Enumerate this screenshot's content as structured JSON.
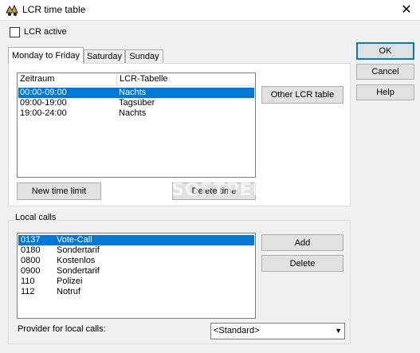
{
  "window": {
    "title": "LCR time table",
    "close_glyph": "✕"
  },
  "lcr_active": {
    "label": "LCR active",
    "checked": false
  },
  "tabs": [
    {
      "label": "Monday to Friday",
      "active": true
    },
    {
      "label": "Saturday",
      "active": false
    },
    {
      "label": "Sunday",
      "active": false
    }
  ],
  "time_table": {
    "columns": [
      "Zeitraum",
      "LCR-Tabelle"
    ],
    "rows": [
      {
        "time": "00:00-09:00",
        "table": "Nachts",
        "selected": true
      },
      {
        "time": "09:00-19:00",
        "table": "Tagsüber",
        "selected": false
      },
      {
        "time": "19:00-24:00",
        "table": "Nachts",
        "selected": false
      }
    ],
    "other_button": "Other LCR table",
    "new_button": "New time limit",
    "delete_button": "Delete time"
  },
  "local_calls": {
    "group_label": "Local calls",
    "rows": [
      {
        "code": "0137",
        "name": "Vote-Call",
        "selected": true
      },
      {
        "code": "0180",
        "name": "Sondertarif",
        "selected": false
      },
      {
        "code": "0800",
        "name": "Kostenlos",
        "selected": false
      },
      {
        "code": "0900",
        "name": "Sondertarif",
        "selected": false
      },
      {
        "code": "110",
        "name": "Polizei",
        "selected": false
      },
      {
        "code": "112",
        "name": "Notruf",
        "selected": false
      }
    ],
    "add_button": "Add",
    "delete_button": "Delete",
    "provider_label": "Provider for local calls:",
    "provider_value": "<Standard>"
  },
  "dialog_buttons": {
    "ok": "OK",
    "cancel": "Cancel",
    "help": "Help"
  },
  "watermark": "SOFTPEDIA",
  "colors": {
    "selection": "#0078d7",
    "default_button_border": "#0078d7"
  }
}
